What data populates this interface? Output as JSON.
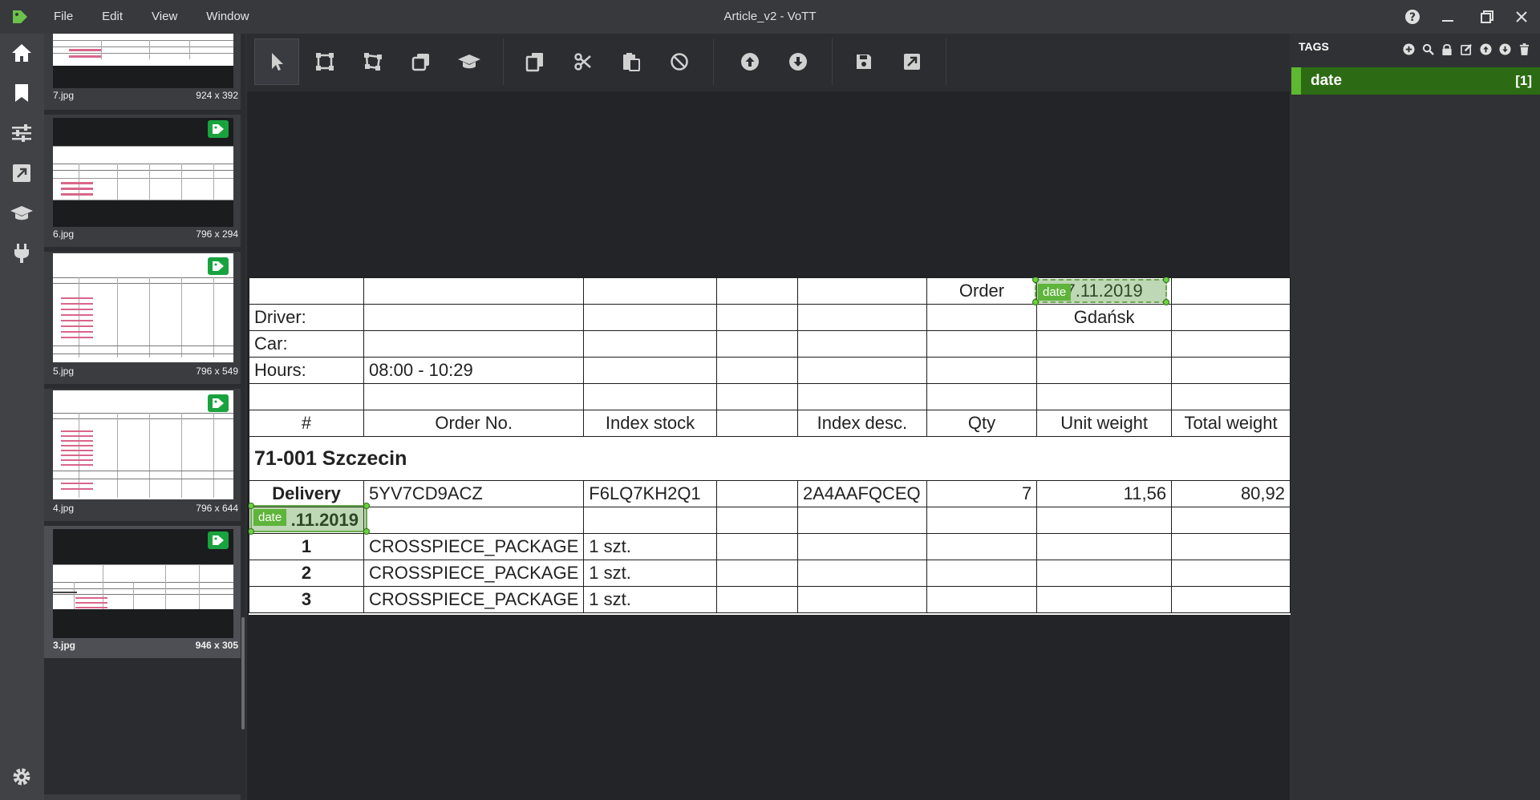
{
  "app": {
    "title": "Article_v2 - VoTT",
    "menu": [
      "File",
      "Edit",
      "View",
      "Window"
    ]
  },
  "sidebar": {
    "icons": [
      "home-icon",
      "bookmark-icon",
      "sliders-icon",
      "export-icon",
      "graduation-cap-icon",
      "plug-icon",
      "gear-icon"
    ]
  },
  "thumbnails": [
    {
      "name": "7.jpg",
      "dims": "924 x 392",
      "tagged": false
    },
    {
      "name": "6.jpg",
      "dims": "796 x 294",
      "tagged": true
    },
    {
      "name": "5.jpg",
      "dims": "796 x 549",
      "tagged": true
    },
    {
      "name": "4.jpg",
      "dims": "796 x 644",
      "tagged": true
    },
    {
      "name": "3.jpg",
      "dims": "946 x 305",
      "tagged": true
    }
  ],
  "toolbar": {
    "tools": [
      "select-pointer-icon",
      "draw-rectangle-icon",
      "draw-polygon-icon",
      "copy-rectangle-icon",
      "active-learning-icon",
      "copy-regions-icon",
      "cut-regions-icon",
      "paste-regions-icon",
      "remove-regions-icon",
      "previous-asset-icon",
      "next-asset-icon",
      "save-project-icon",
      "export-project-icon"
    ]
  },
  "document": {
    "header_order": "Order",
    "order_date": "7.11.2019",
    "driver_label": "Driver:",
    "city": "Gdańsk",
    "car_label": "Car:",
    "hours_label": "Hours:",
    "hours_value": "08:00 - 10:29",
    "columns": [
      "#",
      "Order No.",
      "Index stock",
      "Index desc.",
      "Qty",
      "Unit weight",
      "Total weight"
    ],
    "section": "71-001 Szczecin",
    "delivery": {
      "label": "Delivery",
      "order_no": "5YV7CD9ACZ",
      "index_stock": "F6LQ7KH2Q1",
      "index_desc": "2A4AAFQCEQ",
      "qty": "7",
      "unit_weight": "11,56",
      "total_weight": "80,92"
    },
    "delivery_date": ".11.2019",
    "items": [
      {
        "n": "1",
        "name": "CROSSPIECE_PACKAGE",
        "qty": "1 szt."
      },
      {
        "n": "2",
        "name": "CROSSPIECE_PACKAGE",
        "qty": "1 szt."
      },
      {
        "n": "3",
        "name": "CROSSPIECE_PACKAGE",
        "qty": "1 szt."
      }
    ]
  },
  "regions": [
    {
      "tag": "date"
    },
    {
      "tag": "date"
    }
  ],
  "tags_panel": {
    "title": "TAGS",
    "tags": [
      {
        "name": "date",
        "count": "[1]"
      }
    ]
  },
  "colors": {
    "accent_green": "#5eb831",
    "tag_row_bg": "#2c6b13",
    "item_red": "#c0426b"
  }
}
